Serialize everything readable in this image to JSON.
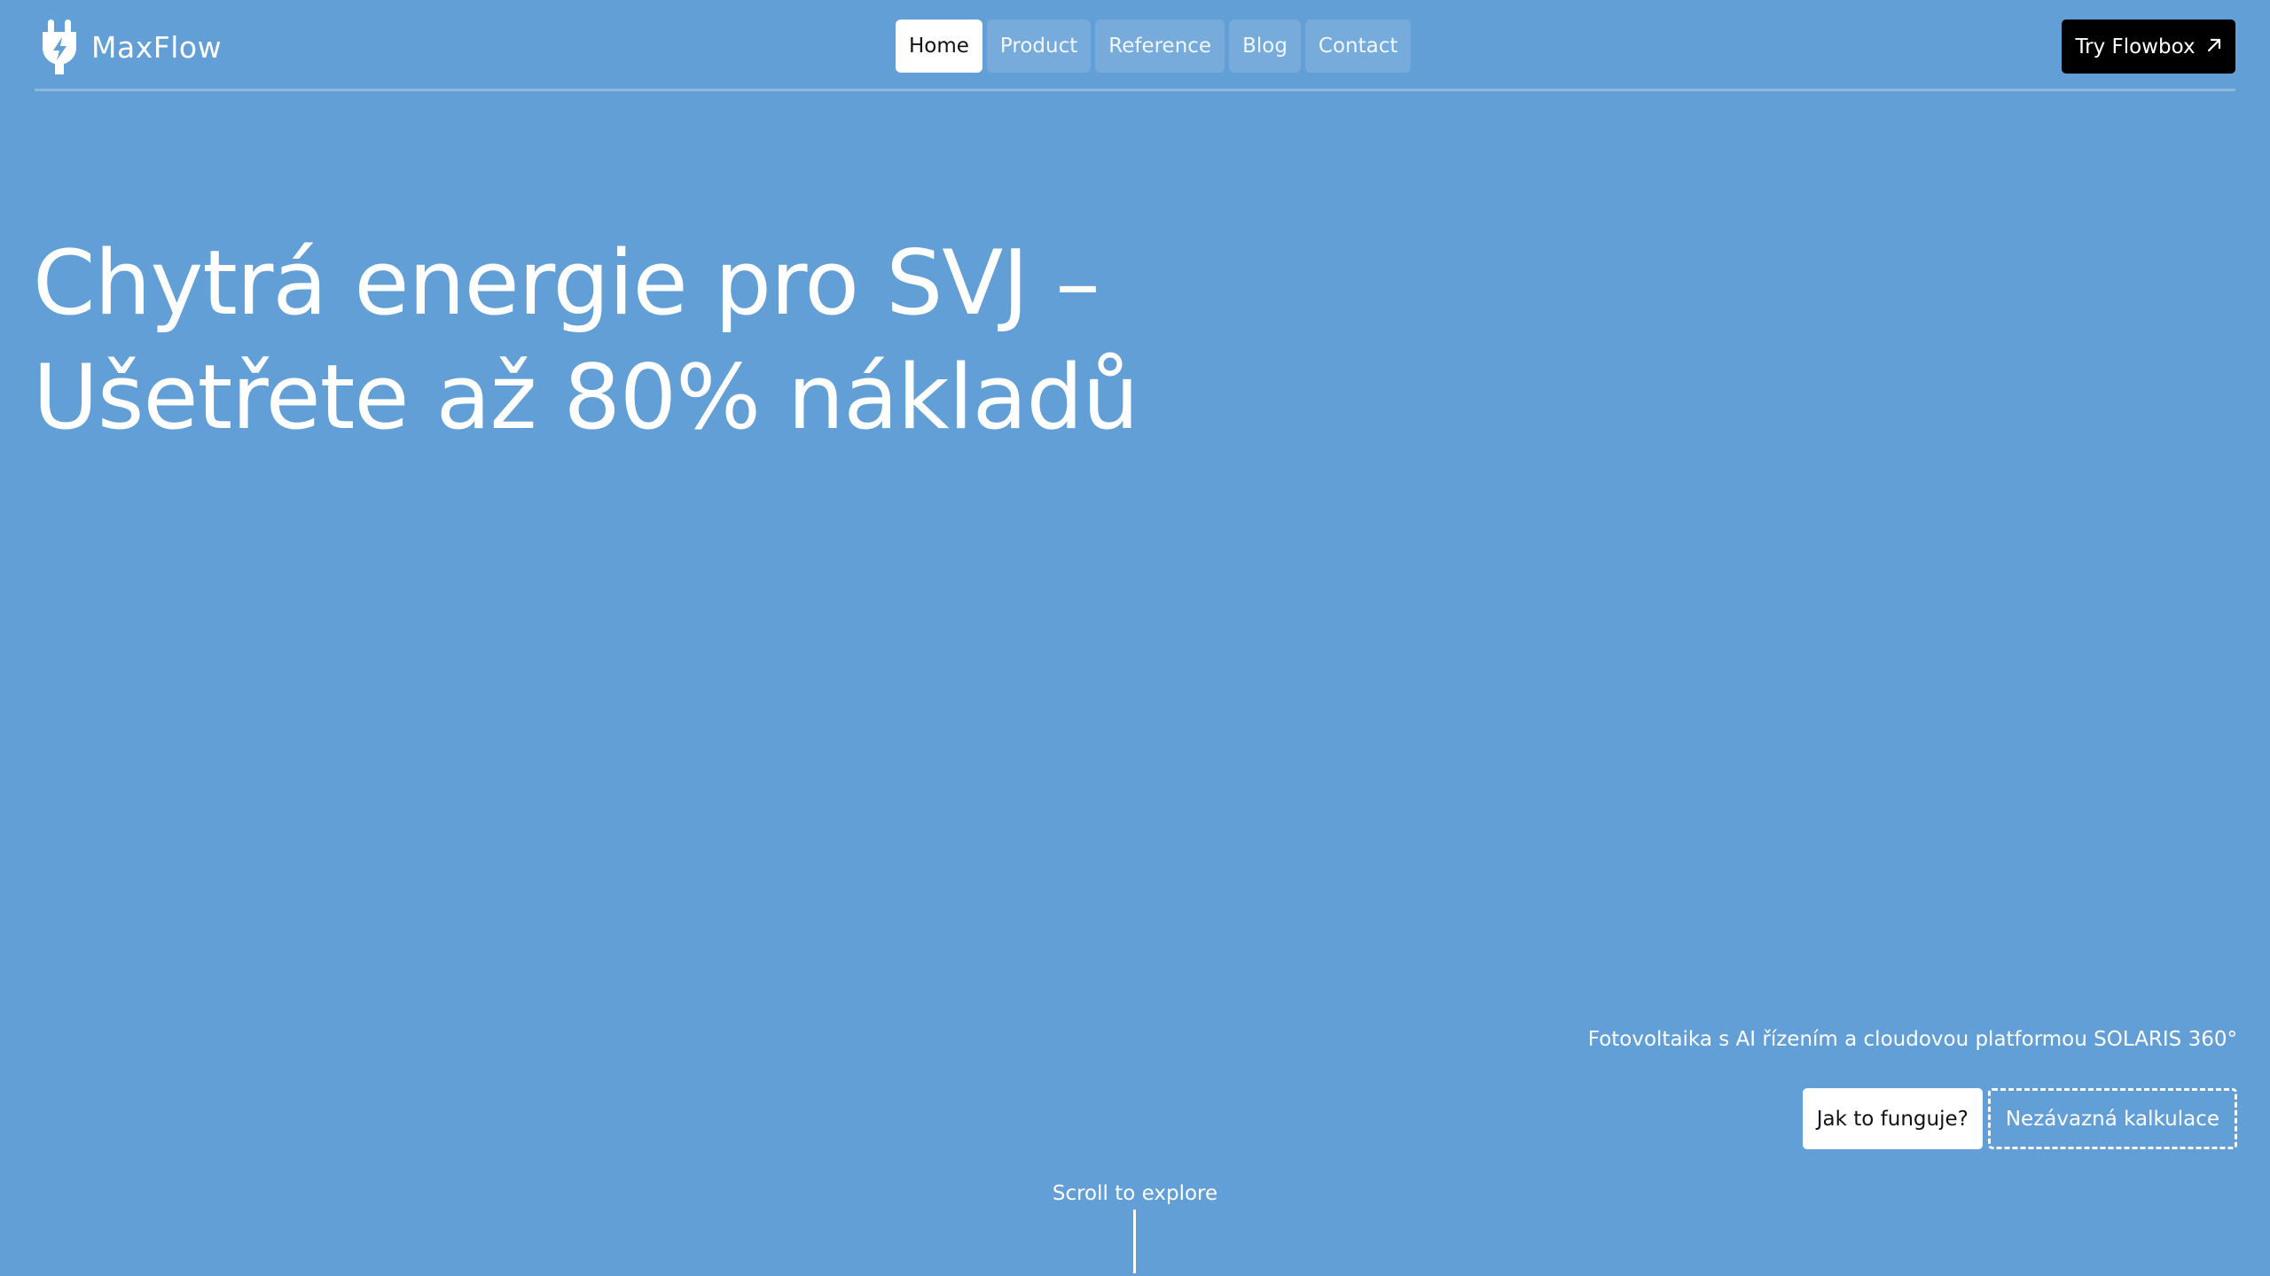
{
  "brand": {
    "name": "MaxFlow",
    "logo_icon": "plug-bolt-icon"
  },
  "nav": {
    "items": [
      {
        "label": "Home",
        "active": true
      },
      {
        "label": "Product",
        "active": false
      },
      {
        "label": "Reference",
        "active": false
      },
      {
        "label": "Blog",
        "active": false
      },
      {
        "label": "Contact",
        "active": false
      }
    ]
  },
  "header_cta": {
    "label": "Try Flowbox",
    "icon": "arrow-up-right-icon"
  },
  "hero": {
    "title_line1": "Chytrá energie pro SVJ –",
    "title_line2": "Ušetřete až 80% nákladů"
  },
  "tagline": "Fotovoltaika s AI řízením a cloudovou platformou SOLARIS 360°",
  "actions": {
    "primary": "Jak to funguje?",
    "secondary": "Nezávazná kalkulace"
  },
  "scroll_hint": "Scroll to explore",
  "colors": {
    "background": "#629fd6",
    "text": "#ffffff",
    "cta_background": "#000000"
  }
}
